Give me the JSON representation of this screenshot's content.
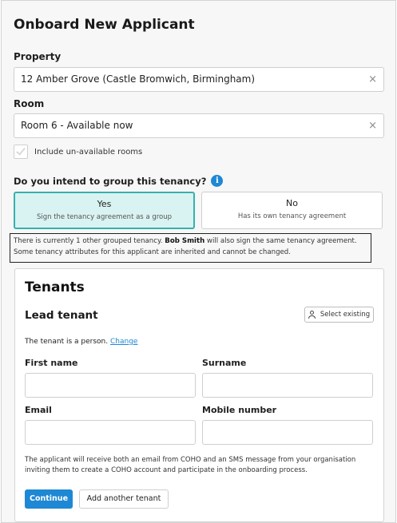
{
  "page": {
    "title": "Onboard New Applicant"
  },
  "property": {
    "label": "Property",
    "value": "12 Amber Grove (Castle Bromwich, Birmingham)",
    "clear": "×"
  },
  "room": {
    "label": "Room",
    "value": "Room 6 - Available now",
    "clear": "×"
  },
  "include_unavailable": {
    "label": "Include un-available rooms",
    "checked": false
  },
  "group_question": {
    "label": "Do you intend to group this tenancy?",
    "info": "i"
  },
  "group_options": [
    {
      "title": "Yes",
      "subtitle": "Sign the tenancy agreement as a group",
      "selected": true
    },
    {
      "title": "No",
      "subtitle": "Has its own tenancy agreement",
      "selected": false
    }
  ],
  "notice": {
    "prefix": "There is currently 1 other grouped tenancy. ",
    "name": "Bob Smith",
    "suffix": " will also sign the same tenancy agreement.",
    "line2": "Some tenancy attributes for this applicant are inherited and cannot be changed."
  },
  "tenants": {
    "title": "Tenants",
    "lead_title": "Lead tenant",
    "select_existing": "Select existing",
    "person_text": "The tenant is a person.",
    "change_link": "Change",
    "first_name_label": "First name",
    "surname_label": "Surname",
    "email_label": "Email",
    "mobile_label": "Mobile number",
    "help": "The applicant will receive both an email from COHO and an SMS message from your organisation inviting them to create a COHO account and participate in the onboarding process.",
    "continue": "Continue",
    "add_another": "Add another tenant"
  },
  "colors": {
    "accent": "#1e88d4",
    "selected_bg": "#d8f3f2",
    "selected_border": "#36b1ad"
  }
}
